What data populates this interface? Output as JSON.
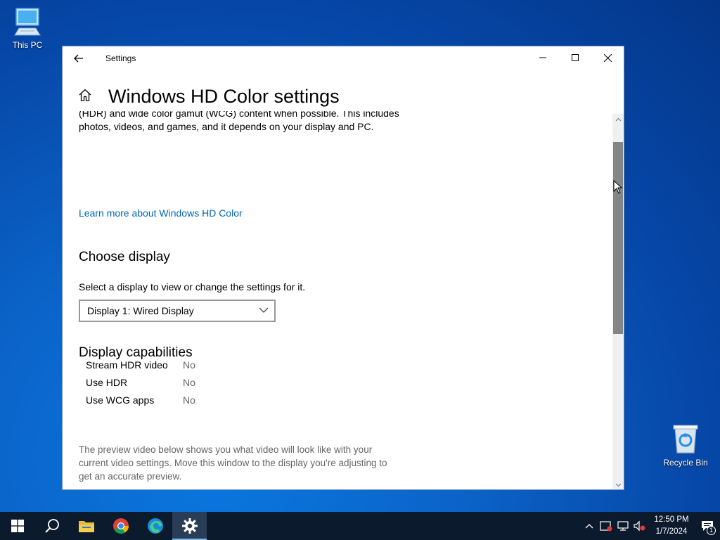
{
  "desktop": {
    "this_pc_label": "This PC",
    "recycle_bin_label": "Recycle Bin"
  },
  "window": {
    "title": "Settings",
    "page_title": "Windows HD Color settings"
  },
  "content": {
    "clipped_line": "(HDR) and wide color gamut (WCG) content when possible. This includes",
    "intro_line": "photos, videos, and games, and it depends on your display and PC.",
    "learn_more_link": "Learn more about Windows HD Color",
    "choose_display_heading": "Choose display",
    "choose_display_desc": "Select a display to view or change the settings for it.",
    "display_dropdown_value": "Display 1: Wired Display",
    "capabilities_heading": "Display capabilities",
    "capabilities": [
      {
        "label": "Stream HDR video",
        "value": "No"
      },
      {
        "label": "Use HDR",
        "value": "No"
      },
      {
        "label": "Use WCG apps",
        "value": "No"
      }
    ],
    "preview_text": "The preview video below shows you what video will look like with your current video settings. Move this window to the display you're adjusting to get an accurate preview."
  },
  "taskbar": {
    "time": "12:50 PM",
    "date": "1/7/2024",
    "notification_count": "1"
  },
  "colors": {
    "accent": "#0067b8",
    "taskbar_bg": "#0c1a2e"
  }
}
